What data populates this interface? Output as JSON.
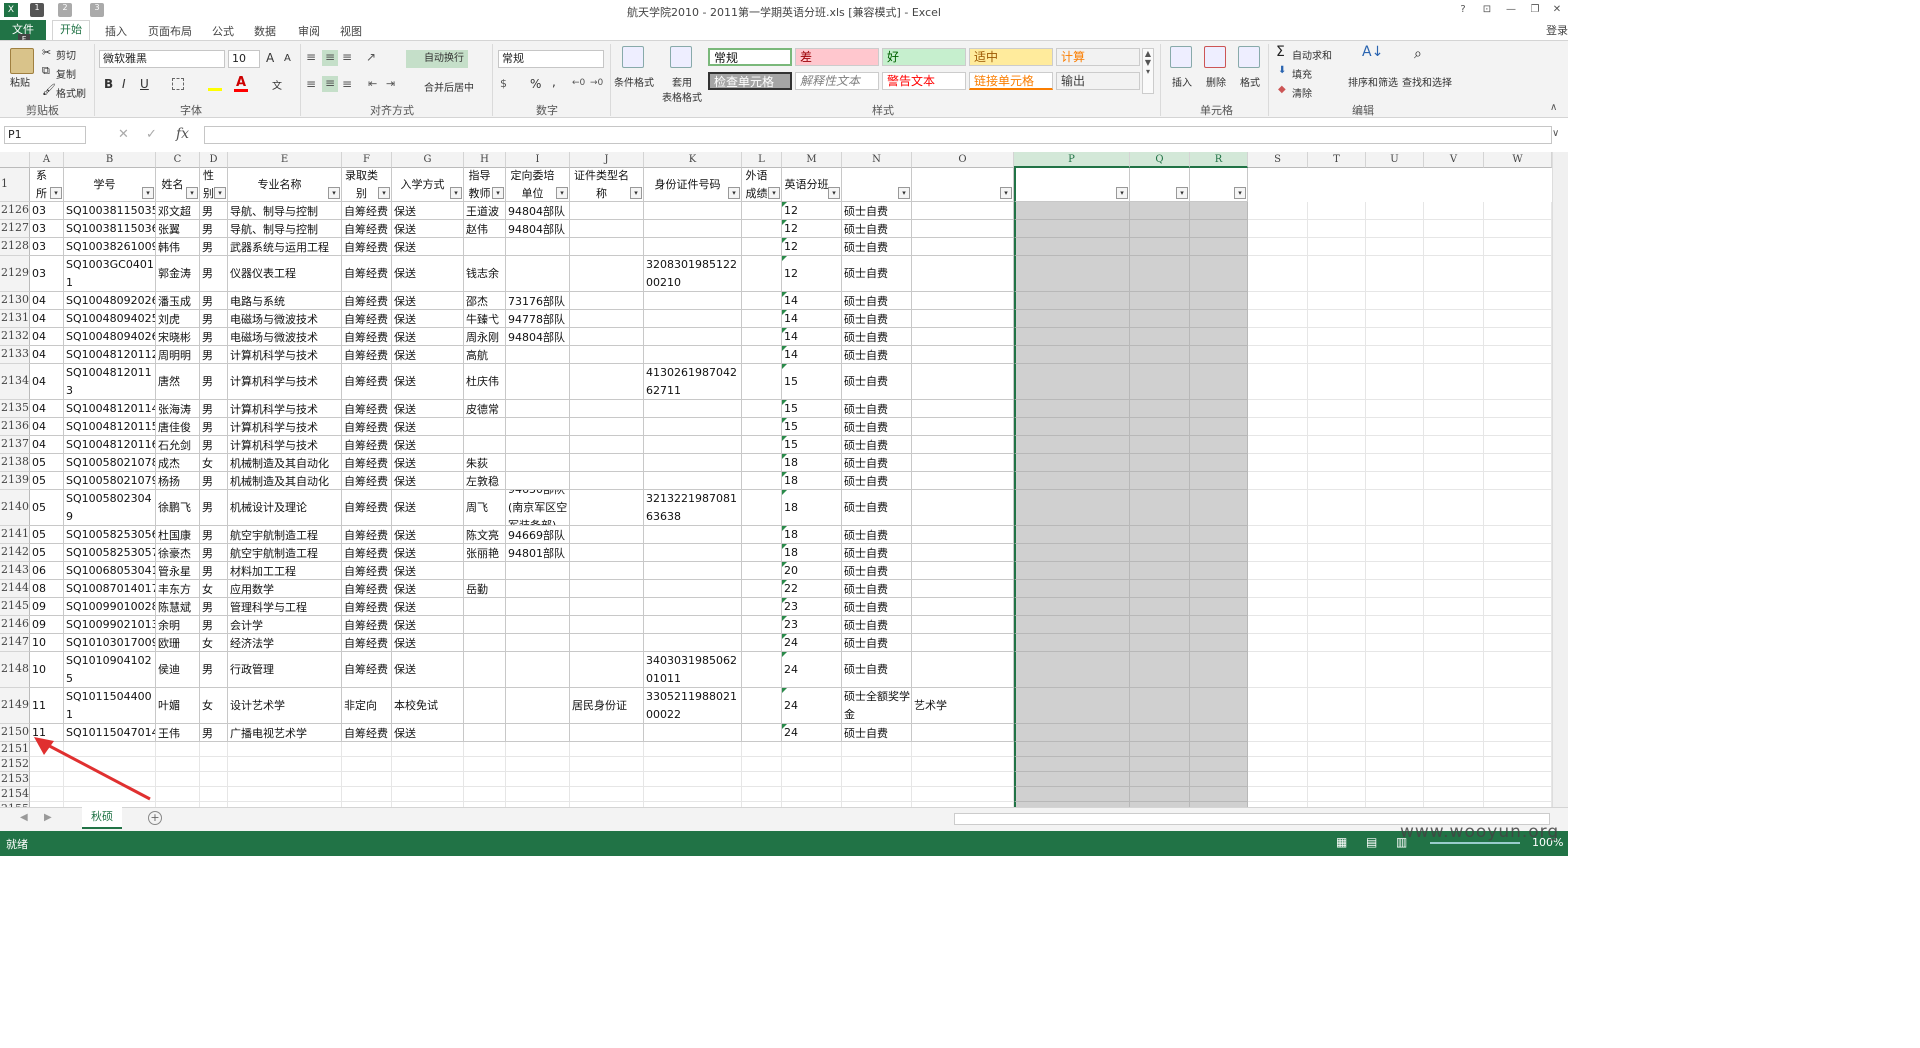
{
  "window": {
    "title": "航天学院2010 - 2011第一学期英语分班.xls  [兼容模式] - Excel",
    "qat_keys": [
      "1",
      "2",
      "3"
    ],
    "file_key": "F",
    "login": "登录"
  },
  "tabs": [
    "文件",
    "开始",
    "插入",
    "页面布局",
    "公式",
    "数据",
    "审阅",
    "视图"
  ],
  "ribbon": {
    "clipboard": {
      "paste": "粘贴",
      "cut": "剪切",
      "copy": "复制",
      "format_painter": "格式刷",
      "label": "剪贴板"
    },
    "font": {
      "name": "微软雅黑",
      "size": "10",
      "label": "字体",
      "bold": "B",
      "italic": "I",
      "underline": "U",
      "grow": "A",
      "shrink": "A"
    },
    "alignment": {
      "wrap": "自动换行",
      "merge": "合并后居中",
      "label": "对齐方式"
    },
    "number": {
      "format": "常规",
      "percent": "%",
      "comma": ",",
      "label": "数字"
    },
    "styles": {
      "cond_format": "条件格式",
      "table_format": "套用\n表格格式",
      "cells": [
        {
          "text": "常规",
          "bg": "#ffffff",
          "color": "#111111"
        },
        {
          "text": "差",
          "bg": "#ffc7ce",
          "color": "#9c0006"
        },
        {
          "text": "好",
          "bg": "#c6efce",
          "color": "#006100"
        },
        {
          "text": "适中",
          "bg": "#ffeb9c",
          "color": "#9c5700"
        },
        {
          "text": "计算",
          "bg": "#f2f2f2",
          "color": "#fa7d00"
        },
        {
          "text": "检查单元格",
          "bg": "#a5a5a5",
          "color": "#ffffff"
        },
        {
          "text": "解释性文本",
          "bg": "#ffffff",
          "color": "#7f7f7f"
        },
        {
          "text": "警告文本",
          "bg": "#ffffff",
          "color": "#ff0000"
        },
        {
          "text": "链接单元格",
          "bg": "#ffffff",
          "color": "#fa7d00"
        },
        {
          "text": "输出",
          "bg": "#f2f2f2",
          "color": "#3f3f3f"
        }
      ],
      "label": "样式"
    },
    "cells_group": {
      "insert": "插入",
      "delete": "删除",
      "format": "格式",
      "label": "单元格"
    },
    "editing": {
      "autosum": "自动求和",
      "fill": "填充",
      "clear": "清除",
      "sort": "排序和筛选",
      "find": "查找和选择",
      "label": "编辑"
    }
  },
  "formula_bar": {
    "name_box": "P1",
    "fx": "fx",
    "value": ""
  },
  "columns": [
    "A",
    "B",
    "C",
    "D",
    "E",
    "F",
    "G",
    "H",
    "I",
    "J",
    "K",
    "L",
    "M",
    "N",
    "O",
    "P",
    "Q",
    "R",
    "S",
    "T",
    "U",
    "V",
    "W"
  ],
  "selected_columns": [
    "P",
    "Q",
    "R"
  ],
  "header_row": {
    "row_num": "1",
    "labels": [
      "院系所代",
      "学号",
      "姓名",
      "性别",
      "专业名称",
      "录取类别",
      "入学方式",
      "指导教师",
      "定向委培单位",
      "证件类型名称",
      "身份证件号码",
      "外语成绩",
      "英语分班",
      "",
      "",
      "",
      "",
      ""
    ]
  },
  "rows": [
    {
      "n": "2126",
      "c": [
        "03",
        "SQ10038115035",
        "邓文超",
        "男",
        "导航、制导与控制",
        "自筹经费",
        "保送",
        "王道波",
        "94804部队",
        "",
        "",
        "",
        "12",
        "硕士自费",
        ""
      ]
    },
    {
      "n": "2127",
      "c": [
        "03",
        "SQ10038115036",
        "张翼",
        "男",
        "导航、制导与控制",
        "自筹经费",
        "保送",
        "赵伟",
        "94804部队",
        "",
        "",
        "",
        "12",
        "硕士自费",
        ""
      ]
    },
    {
      "n": "2128",
      "c": [
        "03",
        "SQ10038261009",
        "韩伟",
        "男",
        "武器系统与运用工程",
        "自筹经费",
        "保送",
        "",
        "",
        "",
        "",
        "",
        "12",
        "硕士自费",
        ""
      ]
    },
    {
      "n": "2129",
      "c": [
        "03",
        "SQ1003GC04011",
        "郭金涛",
        "男",
        "仪器仪表工程",
        "自筹经费",
        "保送",
        "钱志余",
        "",
        "",
        "320830198512200210",
        "",
        "12",
        "硕士自费",
        ""
      ]
    },
    {
      "n": "2130",
      "c": [
        "04",
        "SQ10048092026",
        "潘玉成",
        "男",
        "电路与系统",
        "自筹经费",
        "保送",
        "邵杰",
        "73176部队",
        "",
        "",
        "",
        "14",
        "硕士自费",
        ""
      ]
    },
    {
      "n": "2131",
      "c": [
        "04",
        "SQ10048094025",
        "刘虎",
        "男",
        "电磁场与微波技术",
        "自筹经费",
        "保送",
        "牛臻弋",
        "94778部队",
        "",
        "",
        "",
        "14",
        "硕士自费",
        ""
      ]
    },
    {
      "n": "2132",
      "c": [
        "04",
        "SQ10048094026",
        "宋晓彬",
        "男",
        "电磁场与微波技术",
        "自筹经费",
        "保送",
        "周永刚",
        "94804部队",
        "",
        "",
        "",
        "14",
        "硕士自费",
        ""
      ]
    },
    {
      "n": "2133",
      "c": [
        "04",
        "SQ10048120112",
        "周明明",
        "男",
        "计算机科学与技术",
        "自筹经费",
        "保送",
        "高航",
        "",
        "",
        "",
        "",
        "14",
        "硕士自费",
        ""
      ]
    },
    {
      "n": "2134",
      "c": [
        "04",
        "SQ10048120113",
        "唐然",
        "男",
        "计算机科学与技术",
        "自筹经费",
        "保送",
        "杜庆伟",
        "",
        "",
        "413026198704262711",
        "",
        "15",
        "硕士自费",
        ""
      ]
    },
    {
      "n": "2135",
      "c": [
        "04",
        "SQ10048120114",
        "张海涛",
        "男",
        "计算机科学与技术",
        "自筹经费",
        "保送",
        "皮德常",
        "",
        "",
        "",
        "",
        "15",
        "硕士自费",
        ""
      ]
    },
    {
      "n": "2136",
      "c": [
        "04",
        "SQ10048120115",
        "唐佳俊",
        "男",
        "计算机科学与技术",
        "自筹经费",
        "保送",
        "",
        "",
        "",
        "",
        "",
        "15",
        "硕士自费",
        ""
      ]
    },
    {
      "n": "2137",
      "c": [
        "04",
        "SQ10048120116",
        "石允剑",
        "男",
        "计算机科学与技术",
        "自筹经费",
        "保送",
        "",
        "",
        "",
        "",
        "",
        "15",
        "硕士自费",
        ""
      ]
    },
    {
      "n": "2138",
      "c": [
        "05",
        "SQ10058021078",
        "成杰",
        "女",
        "机械制造及其自动化",
        "自筹经费",
        "保送",
        "朱荻",
        "",
        "",
        "",
        "",
        "18",
        "硕士自费",
        ""
      ]
    },
    {
      "n": "2139",
      "c": [
        "05",
        "SQ10058021079",
        "杨扬",
        "男",
        "机械制造及其自动化",
        "自筹经费",
        "保送",
        "左敦稳",
        "",
        "",
        "",
        "",
        "18",
        "硕士自费",
        ""
      ]
    },
    {
      "n": "2140",
      "c": [
        "05",
        "SQ10058023049",
        "徐鹏飞",
        "男",
        "机械设计及理论",
        "自筹经费",
        "保送",
        "周飞",
        "94630部队(南京军区空军装备部)",
        "",
        "321322198708163638",
        "",
        "18",
        "硕士自费",
        ""
      ]
    },
    {
      "n": "2141",
      "c": [
        "05",
        "SQ10058253056",
        "杜国康",
        "男",
        "航空宇航制造工程",
        "自筹经费",
        "保送",
        "陈文亮",
        "94669部队",
        "",
        "",
        "",
        "18",
        "硕士自费",
        ""
      ]
    },
    {
      "n": "2142",
      "c": [
        "05",
        "SQ10058253057",
        "徐豪杰",
        "男",
        "航空宇航制造工程",
        "自筹经费",
        "保送",
        "张丽艳",
        "94801部队",
        "",
        "",
        "",
        "18",
        "硕士自费",
        ""
      ]
    },
    {
      "n": "2143",
      "c": [
        "06",
        "SQ10068053041",
        "管永星",
        "男",
        "材料加工工程",
        "自筹经费",
        "保送",
        "",
        "",
        "",
        "",
        "",
        "20",
        "硕士自费",
        ""
      ]
    },
    {
      "n": "2144",
      "c": [
        "08",
        "SQ10087014017",
        "丰东方",
        "女",
        "应用数学",
        "自筹经费",
        "保送",
        "岳勤",
        "",
        "",
        "",
        "",
        "22",
        "硕士自费",
        ""
      ]
    },
    {
      "n": "2145",
      "c": [
        "09",
        "SQ10099010028",
        "陈慧斌",
        "男",
        "管理科学与工程",
        "自筹经费",
        "保送",
        "",
        "",
        "",
        "",
        "",
        "23",
        "硕士自费",
        ""
      ]
    },
    {
      "n": "2146",
      "c": [
        "09",
        "SQ10099021013",
        "余明",
        "男",
        "会计学",
        "自筹经费",
        "保送",
        "",
        "",
        "",
        "",
        "",
        "23",
        "硕士自费",
        ""
      ]
    },
    {
      "n": "2147",
      "c": [
        "10",
        "SQ10103017009",
        "欧珊",
        "女",
        "经济法学",
        "自筹经费",
        "保送",
        "",
        "",
        "",
        "",
        "",
        "24",
        "硕士自费",
        ""
      ]
    },
    {
      "n": "2148",
      "c": [
        "10",
        "SQ10109041025",
        "侯迪",
        "男",
        "行政管理",
        "自筹经费",
        "保送",
        "",
        "",
        "",
        "340303198506201011",
        "",
        "24",
        "硕士自费",
        ""
      ]
    },
    {
      "n": "2149",
      "c": [
        "11",
        "SQ10115044001",
        "叶媚",
        "女",
        "设计艺术学",
        "非定向",
        "本校免试",
        "",
        "",
        "居民身份证",
        "330521198802100022",
        "",
        "24",
        "硕士全额奖学金",
        "艺术学"
      ]
    },
    {
      "n": "2150",
      "c": [
        "11",
        "SQ10115047014",
        "王伟",
        "男",
        "广播电视艺术学",
        "自筹经费",
        "保送",
        "",
        "",
        "",
        "",
        "",
        "24",
        "硕士自费",
        ""
      ]
    }
  ],
  "empty_rows": [
    "2151",
    "2152",
    "2153",
    "2154",
    "2155"
  ],
  "sheet_tab": "秋硕",
  "status": {
    "ready": "就绪",
    "zoom": "100%"
  },
  "watermark": "www.wooyun.org"
}
